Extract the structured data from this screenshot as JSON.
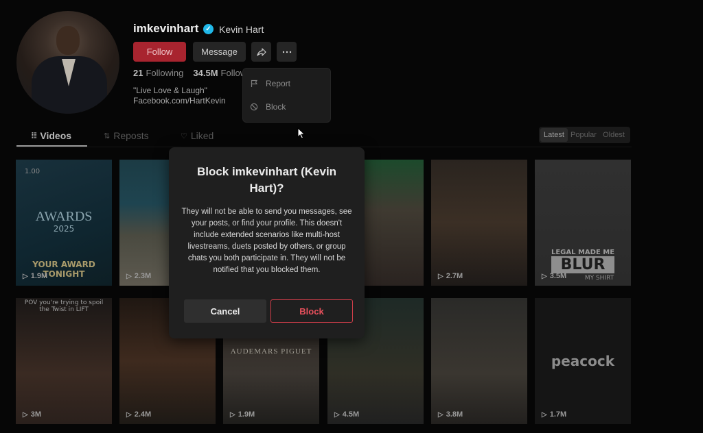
{
  "profile": {
    "username": "imkevinhart",
    "display_name": "Kevin Hart",
    "follow_label": "Follow",
    "message_label": "Message",
    "following_count": "21",
    "following_label": "Following",
    "followers_count": "34.5M",
    "followers_label": "Followers",
    "bio_line1": "\"Live Love & Laugh\"",
    "bio_line2": "Facebook.com/HartKevin"
  },
  "menu": {
    "items": [
      {
        "label": "Report",
        "icon": "flag-icon"
      },
      {
        "label": "Block",
        "icon": "block-icon"
      }
    ]
  },
  "tabs": [
    {
      "label": "Videos",
      "active": true
    },
    {
      "label": "Reposts",
      "active": false
    },
    {
      "label": "Liked",
      "active": false
    }
  ],
  "sort": {
    "options": [
      "Latest",
      "Popular",
      "Oldest"
    ],
    "selected": "Latest"
  },
  "videos": [
    {
      "views": "1.9M",
      "caption_top": "1.00",
      "overlay": "AWARDS",
      "overlay2": "2025",
      "caption_bottom": "YOUR AWARD TONIGHT"
    },
    {
      "views": "2.3M"
    },
    {
      "views": ""
    },
    {
      "views": ""
    },
    {
      "views": "2.7M"
    },
    {
      "views": "3.5M",
      "overlay": "LEGAL MADE ME",
      "overlay2": "BLUR",
      "caption_bottom": "MY SHIRT"
    },
    {
      "views": "3M",
      "caption_top": "POV you're trying to spoil the Twist in LIFT"
    },
    {
      "views": "2.4M"
    },
    {
      "views": "1.9M",
      "overlay": "AUDEMARS PIGUET"
    },
    {
      "views": "4.5M"
    },
    {
      "views": "3.8M"
    },
    {
      "views": "1.7M",
      "overlay": "peacock"
    }
  ],
  "modal": {
    "title": "Block imkevinhart (Kevin Hart)?",
    "body": "They will not be able to send you messages, see your posts, or find your profile. This doesn't include extended scenarios like multi-host livestreams, duets posted by others, or group chats you both participate in. They will not be notified that you blocked them.",
    "cancel_label": "Cancel",
    "block_label": "Block"
  },
  "colors": {
    "accent_red": "#a8242f",
    "block_red": "#e8505c",
    "verified_blue": "#20b8e8"
  }
}
